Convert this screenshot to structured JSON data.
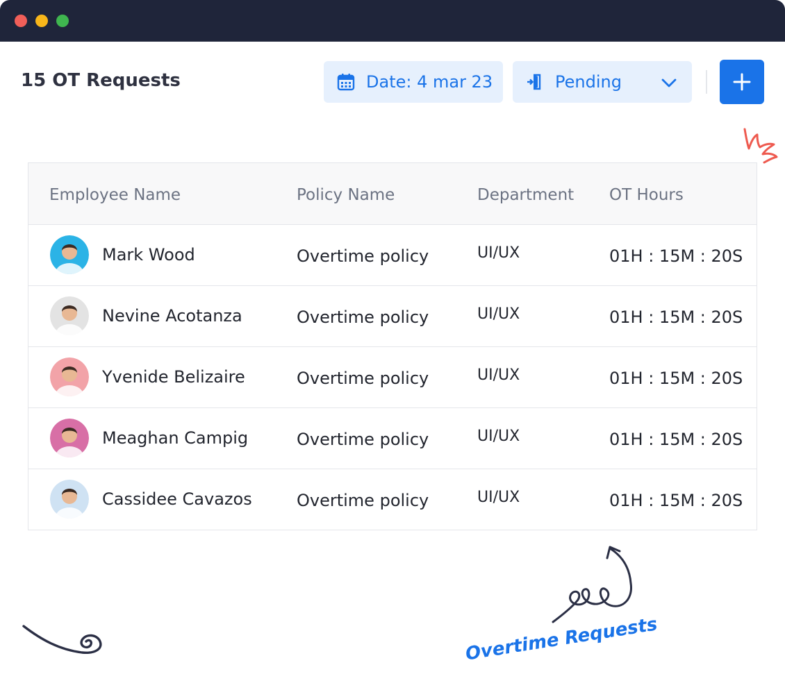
{
  "window": {
    "controls": [
      "close",
      "minimize",
      "maximize"
    ]
  },
  "header": {
    "title": "15 OT Requests",
    "date_filter": {
      "label": "Date: 4 mar 23",
      "icon": "calendar-icon"
    },
    "status_filter": {
      "label": "Pending",
      "icon": "door-enter-icon",
      "chevron": "chevron-down-icon"
    },
    "add_button": {
      "icon": "plus-icon"
    }
  },
  "table": {
    "columns": [
      "Employee Name",
      "Policy Name",
      "Department",
      "OT Hours"
    ],
    "rows": [
      {
        "name": "Mark Wood",
        "policy": "Overtime policy",
        "department": "UI/UX",
        "hours": "01H : 15M : 20S",
        "avatar_bg": "#2bb3e6"
      },
      {
        "name": "Nevine Acotanza",
        "policy": "Overtime policy",
        "department": "UI/UX",
        "hours": "01H : 15M : 20S",
        "avatar_bg": "#e3e3e3"
      },
      {
        "name": "Yvenide Belizaire",
        "policy": "Overtime policy",
        "department": "UI/UX",
        "hours": "01H : 15M : 20S",
        "avatar_bg": "#f2a3a8"
      },
      {
        "name": "Meaghan Campig",
        "policy": "Overtime policy",
        "department": "UI/UX",
        "hours": "01H : 15M : 20S",
        "avatar_bg": "#d86fa6"
      },
      {
        "name": "Cassidee Cavazos",
        "policy": "Overtime policy",
        "department": "UI/UX",
        "hours": "01H : 15M : 20S",
        "avatar_bg": "#cfe2f3"
      }
    ]
  },
  "caption": "Overtime Requests",
  "colors": {
    "titlebar": "#1f253a",
    "accent": "#1a73e8",
    "filter_bg": "#e6f0fd",
    "decoration_red": "#ee5a4f",
    "decoration_dark": "#2b2f45"
  }
}
